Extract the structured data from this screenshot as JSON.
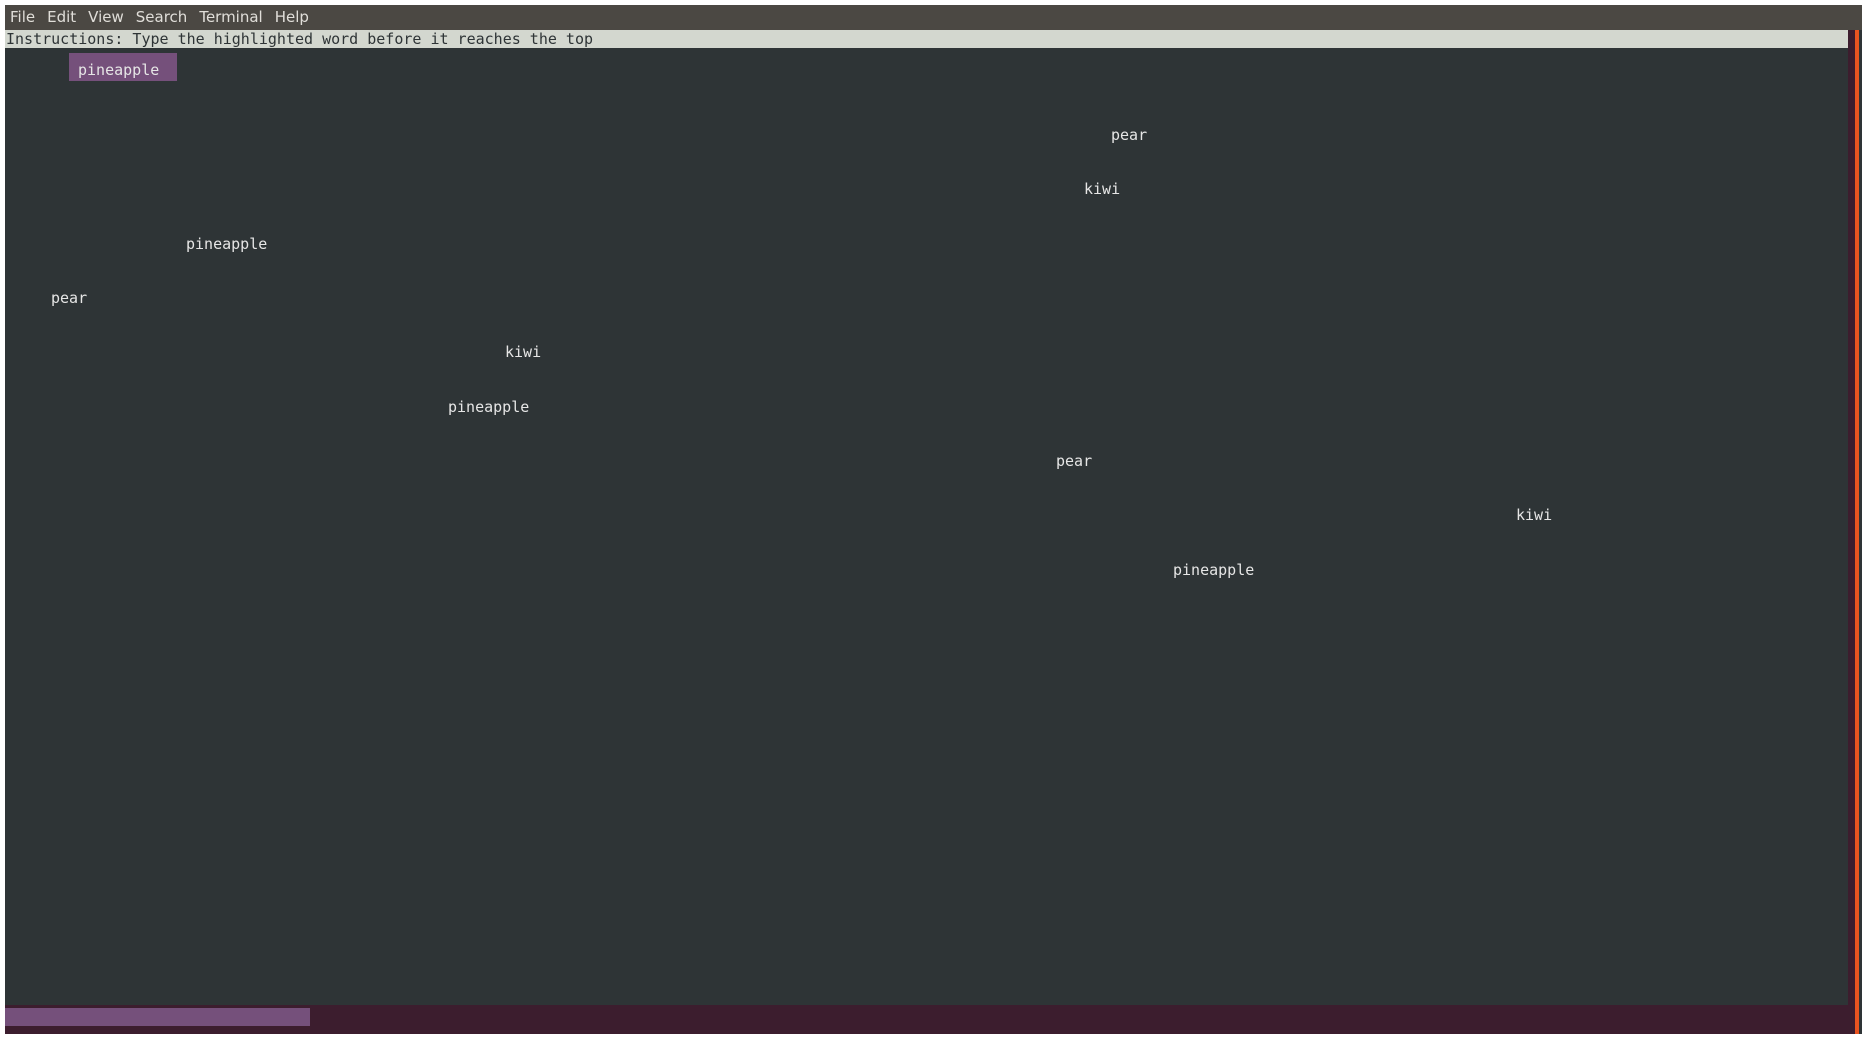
{
  "menu": {
    "items": [
      "File",
      "Edit",
      "View",
      "Search",
      "Terminal",
      "Help"
    ]
  },
  "instructions": "Instructions: Type the highlighted word before it reaches the top",
  "words": [
    {
      "text": "pineapple",
      "highlighted": true
    },
    {
      "text": "pear",
      "highlighted": false
    },
    {
      "text": "kiwi",
      "highlighted": false
    },
    {
      "text": "pineapple",
      "highlighted": false
    },
    {
      "text": "pear",
      "highlighted": false
    },
    {
      "text": "kiwi",
      "highlighted": false
    },
    {
      "text": "pineapple",
      "highlighted": false
    },
    {
      "text": "pear",
      "highlighted": false
    },
    {
      "text": "kiwi",
      "highlighted": false
    },
    {
      "text": "pineapple",
      "highlighted": false
    }
  ],
  "progress": {
    "fraction": 0.165
  },
  "colors": {
    "terminal_bg": "#2e3436",
    "highlight": "#75507b",
    "accent": "#e95420",
    "bottom_bar": "#3c1d2e"
  }
}
